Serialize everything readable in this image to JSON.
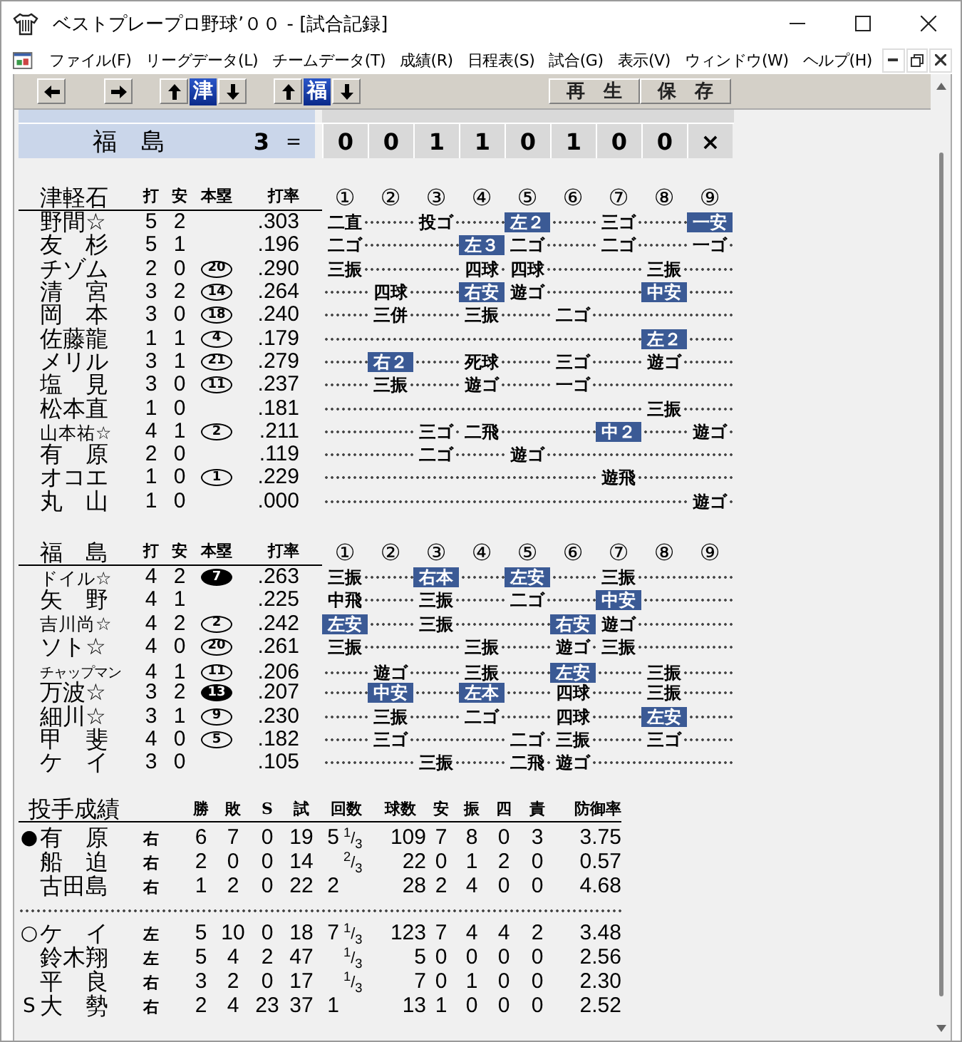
{
  "window": {
    "title": "ベストプレープロ野球’００ - [試合記録]"
  },
  "menu": [
    "ファイル(F)",
    "リーグデータ(L)",
    "チームデータ(T)",
    "成績(R)",
    "日程表(S)",
    "試合(G)",
    "表示(V)",
    "ウィンドウ(W)",
    "ヘルプ(H)"
  ],
  "toolbar": {
    "team_selectors": [
      {
        "team": "津",
        "selected": true
      },
      {
        "team": "福",
        "selected": true
      }
    ],
    "buttons": [
      "再　生",
      "保　存"
    ]
  },
  "scoreboard": {
    "rows": [
      {
        "team": "福　島",
        "runs": "3",
        "separator": "＝",
        "innings": [
          "0",
          "0",
          "1",
          "1",
          "0",
          "1",
          "0",
          "0",
          "×"
        ]
      }
    ]
  },
  "batting": [
    {
      "team": "津軽石",
      "columns": [
        "打",
        "安",
        "本塁",
        "打率"
      ],
      "innings": [
        "①",
        "②",
        "③",
        "④",
        "⑤",
        "⑥",
        "⑦",
        "⑧",
        "⑨"
      ],
      "batters": [
        {
          "name": "野間☆",
          "ab": "5",
          "h": "2",
          "avg": ".303",
          "results": [
            {
              "kind": "out",
              "text": "二直"
            },
            {
              "kind": "blank"
            },
            {
              "kind": "out",
              "text": "投ゴ"
            },
            {
              "kind": "blank"
            },
            {
              "kind": "hit",
              "text": "左２"
            },
            {
              "kind": "blank"
            },
            {
              "kind": "out",
              "text": "三ゴ"
            },
            {
              "kind": "blank"
            },
            {
              "kind": "hit",
              "text": "一安"
            }
          ]
        },
        {
          "name": "友　杉",
          "ab": "5",
          "h": "1",
          "avg": ".196",
          "results": [
            {
              "kind": "out",
              "text": "二ゴ"
            },
            {
              "kind": "blank"
            },
            {
              "kind": "blank"
            },
            {
              "kind": "hit",
              "text": "左３"
            },
            {
              "kind": "out",
              "text": "二ゴ"
            },
            {
              "kind": "blank"
            },
            {
              "kind": "out",
              "text": "二ゴ"
            },
            {
              "kind": "blank"
            },
            {
              "kind": "out",
              "text": "一ゴ"
            }
          ]
        },
        {
          "name": "チゾム",
          "ab": "2",
          "h": "0",
          "hr": {
            "text": "20",
            "filled": false
          },
          "avg": ".290",
          "results": [
            {
              "kind": "out",
              "text": "三振"
            },
            {
              "kind": "blank"
            },
            {
              "kind": "blank"
            },
            {
              "kind": "out",
              "text": "四球"
            },
            {
              "kind": "out",
              "text": "四球"
            },
            {
              "kind": "blank"
            },
            {
              "kind": "blank"
            },
            {
              "kind": "out",
              "text": "三振"
            },
            {
              "kind": "blank"
            }
          ]
        },
        {
          "name": "清　宮",
          "ab": "3",
          "h": "2",
          "hr": {
            "text": "14",
            "filled": false
          },
          "avg": ".264",
          "results": [
            {
              "kind": "blank"
            },
            {
              "kind": "out",
              "text": "四球"
            },
            {
              "kind": "blank"
            },
            {
              "kind": "hit",
              "text": "右安"
            },
            {
              "kind": "out",
              "text": "遊ゴ"
            },
            {
              "kind": "blank"
            },
            {
              "kind": "blank"
            },
            {
              "kind": "hit",
              "text": "中安"
            },
            {
              "kind": "blank"
            }
          ]
        },
        {
          "name": "岡　本",
          "ab": "3",
          "h": "0",
          "hr": {
            "text": "18",
            "filled": false
          },
          "avg": ".240",
          "results": [
            {
              "kind": "blank"
            },
            {
              "kind": "out",
              "text": "三併"
            },
            {
              "kind": "blank"
            },
            {
              "kind": "out",
              "text": "三振"
            },
            {
              "kind": "blank"
            },
            {
              "kind": "out",
              "text": "二ゴ"
            },
            {
              "kind": "blank"
            },
            {
              "kind": "blank"
            },
            {
              "kind": "blank"
            }
          ]
        },
        {
          "name": "佐藤龍",
          "ab": "1",
          "h": "1",
          "hr": {
            "text": "4",
            "filled": false
          },
          "avg": ".179",
          "results": [
            {
              "kind": "blank"
            },
            {
              "kind": "blank"
            },
            {
              "kind": "blank"
            },
            {
              "kind": "blank"
            },
            {
              "kind": "blank"
            },
            {
              "kind": "blank"
            },
            {
              "kind": "blank"
            },
            {
              "kind": "hit",
              "text": "左２"
            },
            {
              "kind": "blank"
            }
          ]
        },
        {
          "name": "メリル",
          "ab": "3",
          "h": "1",
          "hr": {
            "text": "21",
            "filled": false
          },
          "avg": ".279",
          "results": [
            {
              "kind": "blank"
            },
            {
              "kind": "hit",
              "text": "右２"
            },
            {
              "kind": "blank"
            },
            {
              "kind": "out",
              "text": "死球"
            },
            {
              "kind": "blank"
            },
            {
              "kind": "out",
              "text": "三ゴ"
            },
            {
              "kind": "blank"
            },
            {
              "kind": "out",
              "text": "遊ゴ"
            },
            {
              "kind": "blank"
            }
          ]
        },
        {
          "name": "塩　見",
          "ab": "3",
          "h": "0",
          "hr": {
            "text": "11",
            "filled": false
          },
          "avg": ".237",
          "results": [
            {
              "kind": "blank"
            },
            {
              "kind": "out",
              "text": "三振"
            },
            {
              "kind": "blank"
            },
            {
              "kind": "out",
              "text": "遊ゴ"
            },
            {
              "kind": "blank"
            },
            {
              "kind": "out",
              "text": "一ゴ"
            },
            {
              "kind": "blank"
            },
            {
              "kind": "blank"
            },
            {
              "kind": "blank"
            }
          ]
        },
        {
          "name": "松本直",
          "ab": "1",
          "h": "0",
          "avg": ".181",
          "results": [
            {
              "kind": "blank"
            },
            {
              "kind": "blank"
            },
            {
              "kind": "blank"
            },
            {
              "kind": "blank"
            },
            {
              "kind": "blank"
            },
            {
              "kind": "blank"
            },
            {
              "kind": "blank"
            },
            {
              "kind": "out",
              "text": "三振"
            },
            {
              "kind": "blank"
            }
          ]
        },
        {
          "name": "山本祐☆",
          "ab": "4",
          "h": "1",
          "hr": {
            "text": "2",
            "filled": false
          },
          "avg": ".211",
          "results": [
            {
              "kind": "blank"
            },
            {
              "kind": "blank"
            },
            {
              "kind": "out",
              "text": "三ゴ"
            },
            {
              "kind": "out",
              "text": "二飛"
            },
            {
              "kind": "blank"
            },
            {
              "kind": "blank"
            },
            {
              "kind": "hit",
              "text": "中２"
            },
            {
              "kind": "blank"
            },
            {
              "kind": "out",
              "text": "遊ゴ"
            }
          ]
        },
        {
          "name": "有　原",
          "ab": "2",
          "h": "0",
          "avg": ".119",
          "results": [
            {
              "kind": "blank"
            },
            {
              "kind": "blank"
            },
            {
              "kind": "out",
              "text": "二ゴ"
            },
            {
              "kind": "blank"
            },
            {
              "kind": "out",
              "text": "遊ゴ"
            },
            {
              "kind": "blank"
            },
            {
              "kind": "blank"
            },
            {
              "kind": "blank"
            },
            {
              "kind": "blank"
            }
          ]
        },
        {
          "name": "オコエ",
          "ab": "1",
          "h": "0",
          "hr": {
            "text": "1",
            "filled": false
          },
          "avg": ".229",
          "results": [
            {
              "kind": "blank"
            },
            {
              "kind": "blank"
            },
            {
              "kind": "blank"
            },
            {
              "kind": "blank"
            },
            {
              "kind": "blank"
            },
            {
              "kind": "blank"
            },
            {
              "kind": "out",
              "text": "遊飛"
            },
            {
              "kind": "blank"
            },
            {
              "kind": "blank"
            }
          ]
        },
        {
          "name": "丸　山",
          "ab": "1",
          "h": "0",
          "avg": ".000",
          "results": [
            {
              "kind": "blank"
            },
            {
              "kind": "blank"
            },
            {
              "kind": "blank"
            },
            {
              "kind": "blank"
            },
            {
              "kind": "blank"
            },
            {
              "kind": "blank"
            },
            {
              "kind": "blank"
            },
            {
              "kind": "blank"
            },
            {
              "kind": "out",
              "text": "遊ゴ"
            }
          ]
        }
      ]
    },
    {
      "team": "福　島",
      "columns": [
        "打",
        "安",
        "本塁",
        "打率"
      ],
      "innings": [
        "①",
        "②",
        "③",
        "④",
        "⑤",
        "⑥",
        "⑦",
        "⑧",
        "⑨"
      ],
      "batters": [
        {
          "name": "ドイル☆",
          "ab": "4",
          "h": "2",
          "hr": {
            "text": "7",
            "filled": true
          },
          "avg": ".263",
          "results": [
            {
              "kind": "out",
              "text": "三振"
            },
            {
              "kind": "blank"
            },
            {
              "kind": "hit",
              "text": "右本"
            },
            {
              "kind": "blank"
            },
            {
              "kind": "hit",
              "text": "左安"
            },
            {
              "kind": "blank"
            },
            {
              "kind": "out",
              "text": "三振"
            },
            {
              "kind": "blank"
            },
            {
              "kind": "blank"
            }
          ]
        },
        {
          "name": "矢　野",
          "ab": "4",
          "h": "1",
          "avg": ".225",
          "results": [
            {
              "kind": "out",
              "text": "中飛"
            },
            {
              "kind": "blank"
            },
            {
              "kind": "out",
              "text": "三振"
            },
            {
              "kind": "blank"
            },
            {
              "kind": "out",
              "text": "二ゴ"
            },
            {
              "kind": "blank"
            },
            {
              "kind": "hit",
              "text": "中安"
            },
            {
              "kind": "blank"
            },
            {
              "kind": "blank"
            }
          ]
        },
        {
          "name": "吉川尚☆",
          "ab": "4",
          "h": "2",
          "hr": {
            "text": "2",
            "filled": false
          },
          "avg": ".242",
          "results": [
            {
              "kind": "hit",
              "text": "左安"
            },
            {
              "kind": "blank"
            },
            {
              "kind": "out",
              "text": "三振"
            },
            {
              "kind": "blank"
            },
            {
              "kind": "blank"
            },
            {
              "kind": "hit",
              "text": "右安"
            },
            {
              "kind": "out",
              "text": "遊ゴ"
            },
            {
              "kind": "blank"
            },
            {
              "kind": "blank"
            }
          ]
        },
        {
          "name": "ソト☆",
          "ab": "4",
          "h": "0",
          "hr": {
            "text": "20",
            "filled": false
          },
          "avg": ".261",
          "results": [
            {
              "kind": "out",
              "text": "三振"
            },
            {
              "kind": "blank"
            },
            {
              "kind": "blank"
            },
            {
              "kind": "out",
              "text": "三振"
            },
            {
              "kind": "blank"
            },
            {
              "kind": "out",
              "text": "遊ゴ"
            },
            {
              "kind": "out",
              "text": "三振"
            },
            {
              "kind": "blank"
            },
            {
              "kind": "blank"
            }
          ]
        },
        {
          "name": "チャップマン",
          "ab": "4",
          "h": "1",
          "hr": {
            "text": "11",
            "filled": false
          },
          "avg": ".206",
          "results": [
            {
              "kind": "blank"
            },
            {
              "kind": "out",
              "text": "遊ゴ"
            },
            {
              "kind": "blank"
            },
            {
              "kind": "out",
              "text": "三振"
            },
            {
              "kind": "blank"
            },
            {
              "kind": "hit",
              "text": "左安"
            },
            {
              "kind": "blank"
            },
            {
              "kind": "out",
              "text": "三振"
            },
            {
              "kind": "blank"
            }
          ]
        },
        {
          "name": "万波☆",
          "ab": "3",
          "h": "2",
          "hr": {
            "text": "13",
            "filled": true
          },
          "avg": ".207",
          "results": [
            {
              "kind": "blank"
            },
            {
              "kind": "hit",
              "text": "中安"
            },
            {
              "kind": "blank"
            },
            {
              "kind": "hit",
              "text": "左本"
            },
            {
              "kind": "blank"
            },
            {
              "kind": "out",
              "text": "四球"
            },
            {
              "kind": "blank"
            },
            {
              "kind": "out",
              "text": "三振"
            },
            {
              "kind": "blank"
            }
          ]
        },
        {
          "name": "細川☆",
          "ab": "3",
          "h": "1",
          "hr": {
            "text": "9",
            "filled": false
          },
          "avg": ".230",
          "results": [
            {
              "kind": "blank"
            },
            {
              "kind": "out",
              "text": "三振"
            },
            {
              "kind": "blank"
            },
            {
              "kind": "out",
              "text": "二ゴ"
            },
            {
              "kind": "blank"
            },
            {
              "kind": "out",
              "text": "四球"
            },
            {
              "kind": "blank"
            },
            {
              "kind": "hit",
              "text": "左安"
            },
            {
              "kind": "blank"
            }
          ]
        },
        {
          "name": "甲　斐",
          "ab": "4",
          "h": "0",
          "hr": {
            "text": "5",
            "filled": false
          },
          "avg": ".182",
          "results": [
            {
              "kind": "blank"
            },
            {
              "kind": "out",
              "text": "三ゴ"
            },
            {
              "kind": "blank"
            },
            {
              "kind": "blank"
            },
            {
              "kind": "out",
              "text": "二ゴ"
            },
            {
              "kind": "out",
              "text": "三振"
            },
            {
              "kind": "blank"
            },
            {
              "kind": "out",
              "text": "三ゴ"
            },
            {
              "kind": "blank"
            }
          ]
        },
        {
          "name": "ケ　イ",
          "ab": "3",
          "h": "0",
          "avg": ".105",
          "results": [
            {
              "kind": "blank"
            },
            {
              "kind": "blank"
            },
            {
              "kind": "out",
              "text": "三振"
            },
            {
              "kind": "blank"
            },
            {
              "kind": "out",
              "text": "二飛"
            },
            {
              "kind": "out",
              "text": "遊ゴ"
            },
            {
              "kind": "blank"
            },
            {
              "kind": "blank"
            },
            {
              "kind": "blank"
            }
          ]
        }
      ]
    }
  ],
  "pitching": {
    "title": "投手成績",
    "columns": [
      "勝",
      "敗",
      "S",
      "試",
      "回数",
      "球数",
      "安",
      "振",
      "四",
      "責",
      "防御率"
    ],
    "groups": [
      [
        {
          "mark": "●",
          "name": "有　原",
          "hand": "右",
          "stats_a": [
            "6",
            "7",
            "0",
            "19"
          ],
          "ip": "5",
          "ip_frac": "$^{1}$/$_{3}$",
          "stats_b": [
            "109",
            "7",
            "8",
            "0",
            "3",
            "3.75"
          ]
        },
        {
          "name": "船　迫",
          "hand": "右",
          "stats_a": [
            "2",
            "0",
            "0",
            "14"
          ],
          "ip_frac": "$^{2}$/$_{3}$",
          "stats_b": [
            "22",
            "0",
            "1",
            "2",
            "0",
            "0.57"
          ]
        },
        {
          "name": "古田島",
          "hand": "右",
          "stats_a": [
            "1",
            "2",
            "0",
            "22"
          ],
          "ip": "2",
          "stats_b": [
            "28",
            "2",
            "4",
            "0",
            "0",
            "4.68"
          ]
        }
      ],
      [
        {
          "mark": "○",
          "name": "ケ　イ",
          "hand": "左",
          "stats_a": [
            "5",
            "10",
            "0",
            "18"
          ],
          "ip": "7",
          "ip_frac": "$^{1}$/$_{3}$",
          "stats_b": [
            "123",
            "7",
            "4",
            "4",
            "2",
            "3.48"
          ]
        },
        {
          "name": "鈴木翔",
          "hand": "左",
          "stats_a": [
            "5",
            "4",
            "2",
            "47"
          ],
          "ip_frac": "$^{1}$/$_{3}$",
          "stats_b": [
            "5",
            "0",
            "0",
            "0",
            "0",
            "2.56"
          ]
        },
        {
          "name": "平　良",
          "hand": "右",
          "stats_a": [
            "3",
            "2",
            "0",
            "17"
          ],
          "ip_frac": "$^{1}$/$_{3}$",
          "stats_b": [
            "7",
            "0",
            "1",
            "0",
            "0",
            "2.30"
          ]
        },
        {
          "mark": "S",
          "name": "大　勢",
          "hand": "右",
          "stats_a": [
            "2",
            "4",
            "23",
            "37"
          ],
          "ip": "1",
          "stats_b": [
            "13",
            "1",
            "0",
            "0",
            "0",
            "2.52"
          ]
        }
      ]
    ]
  }
}
